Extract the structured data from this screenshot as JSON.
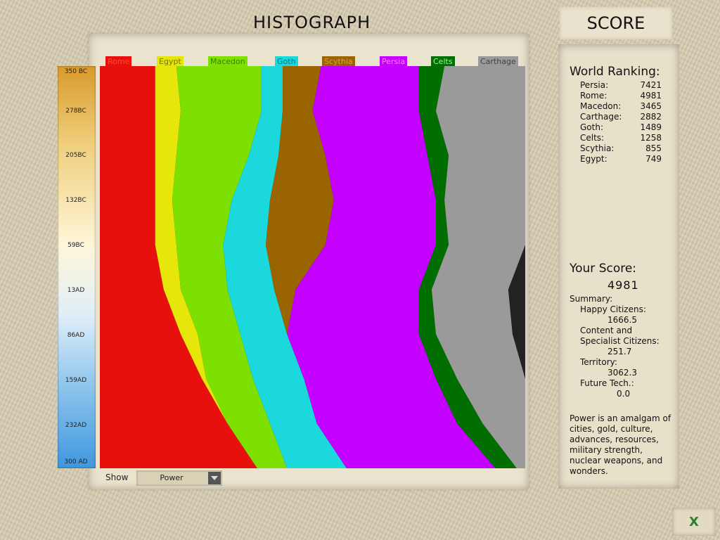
{
  "header": {
    "title": "HISTOGRAPH",
    "score_tab": "SCORE"
  },
  "timeline_labels": [
    "350 BC",
    "278BC",
    "205BC",
    "132BC",
    "59BC",
    "13AD",
    "86AD",
    "159AD",
    "232AD",
    "300 AD"
  ],
  "civilizations": [
    {
      "name": "Rome",
      "color": "#e8100c",
      "label_color": "#ff4a30"
    },
    {
      "name": "Egypt",
      "color": "#e6e60a",
      "label_color": "#777700"
    },
    {
      "name": "Macedon",
      "color": "#7ee000",
      "label_color": "#3a8000"
    },
    {
      "name": "Goth",
      "color": "#1ad8dc",
      "label_color": "#1a6e80"
    },
    {
      "name": "Scythia",
      "color": "#9a6400",
      "label_color": "#e0a040"
    },
    {
      "name": "Persia",
      "color": "#c400ff",
      "label_color": "#ff80ff"
    },
    {
      "name": "Celts",
      "color": "#006e00",
      "label_color": "#90ff90"
    },
    {
      "name": "Carthage",
      "color": "#9a9a9a",
      "label_color": "#444444"
    }
  ],
  "chart_data": {
    "type": "area",
    "title": "HISTOGRAPH",
    "orientation": "vertical-time",
    "x": [
      "350 BC",
      "278BC",
      "205BC",
      "132BC",
      "59BC",
      "13AD",
      "86AD",
      "159AD",
      "232AD",
      "300 AD"
    ],
    "series": [
      {
        "name": "Rome",
        "values": [
          0.13,
          0.13,
          0.13,
          0.13,
          0.13,
          0.15,
          0.19,
          0.24,
          0.3,
          0.37
        ]
      },
      {
        "name": "Egypt",
        "values": [
          0.05,
          0.06,
          0.05,
          0.04,
          0.05,
          0.04,
          0.04,
          0.01,
          0.0,
          0.0
        ]
      },
      {
        "name": "Macedon",
        "values": [
          0.2,
          0.19,
          0.17,
          0.14,
          0.11,
          0.11,
          0.1,
          0.11,
          0.1,
          0.07
        ]
      },
      {
        "name": "Goth",
        "values": [
          0.05,
          0.05,
          0.07,
          0.09,
          0.1,
          0.11,
          0.11,
          0.12,
          0.11,
          0.14
        ]
      },
      {
        "name": "Scythia",
        "values": [
          0.09,
          0.07,
          0.11,
          0.15,
          0.14,
          0.05,
          0.0,
          0.0,
          0.0,
          0.0
        ]
      },
      {
        "name": "Persia",
        "values": [
          0.23,
          0.25,
          0.24,
          0.24,
          0.26,
          0.29,
          0.31,
          0.31,
          0.33,
          0.35
        ]
      },
      {
        "name": "Celts",
        "values": [
          0.06,
          0.04,
          0.05,
          0.02,
          0.03,
          0.03,
          0.04,
          0.05,
          0.06,
          0.05
        ]
      },
      {
        "name": "Carthage",
        "values": [
          0.19,
          0.21,
          0.18,
          0.19,
          0.18,
          0.18,
          0.18,
          0.16,
          0.1,
          0.02
        ]
      }
    ]
  },
  "controls": {
    "show_label": "Show",
    "show_value": "Power"
  },
  "ranking": {
    "title": "World Ranking:",
    "rows": [
      {
        "name": "Persia:",
        "value": "7421"
      },
      {
        "name": "Rome:",
        "value": "4981"
      },
      {
        "name": "Macedon:",
        "value": "3465"
      },
      {
        "name": "Carthage:",
        "value": "2882"
      },
      {
        "name": "Goth:",
        "value": "1489"
      },
      {
        "name": "Celts:",
        "value": "1258"
      },
      {
        "name": "Scythia:",
        "value": "855"
      },
      {
        "name": "Egypt:",
        "value": "749"
      }
    ]
  },
  "score": {
    "title": "Your Score:",
    "value": "4981",
    "summary_label": "Summary:",
    "happy_label": "Happy Citizens:",
    "happy_value": "1666.5",
    "content_label_1": "Content and",
    "content_label_2": "Specialist Citizens:",
    "content_value": "251.7",
    "territory_label": "Territory:",
    "territory_value": "3062.3",
    "future_label": "Future Tech.:",
    "future_value": "0.0"
  },
  "power_description": "Power is an amalgam of cities, gold, culture, advances, resources, military strength, nuclear weapons, and wonders.",
  "exit_button": {
    "label": "X"
  }
}
